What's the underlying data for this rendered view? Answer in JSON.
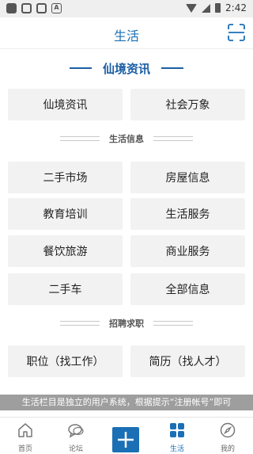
{
  "status_bar": {
    "time": "2:42"
  },
  "header": {
    "title": "生活",
    "scan_icon": "scan-icon"
  },
  "section": {
    "title": "仙境资讯"
  },
  "top_buttons": [
    "仙境资讯",
    "社会万象"
  ],
  "life_info": {
    "title": "生活信息",
    "buttons": [
      "二手市场",
      "房屋信息",
      "教育培训",
      "生活服务",
      "餐饮旅游",
      "商业服务",
      "二手车",
      "全部信息"
    ]
  },
  "jobs": {
    "title": "招聘求职",
    "buttons": [
      "职位（找工作）",
      "简历（找人才）"
    ]
  },
  "notice": "生活栏目是独立的用户系统，根据提示“注册帐号”即可",
  "tabs": [
    {
      "label": "首页",
      "icon": "home-icon"
    },
    {
      "label": "论坛",
      "icon": "chat-icon"
    },
    {
      "label": "",
      "icon": "plus-icon"
    },
    {
      "label": "生活",
      "icon": "grid-icon",
      "active": true
    },
    {
      "label": "我的",
      "icon": "compass-icon"
    }
  ],
  "colors": {
    "accent": "#1a6fb5",
    "button_bg": "#f2f2f2",
    "notice_bg": "#9e9e9e"
  }
}
